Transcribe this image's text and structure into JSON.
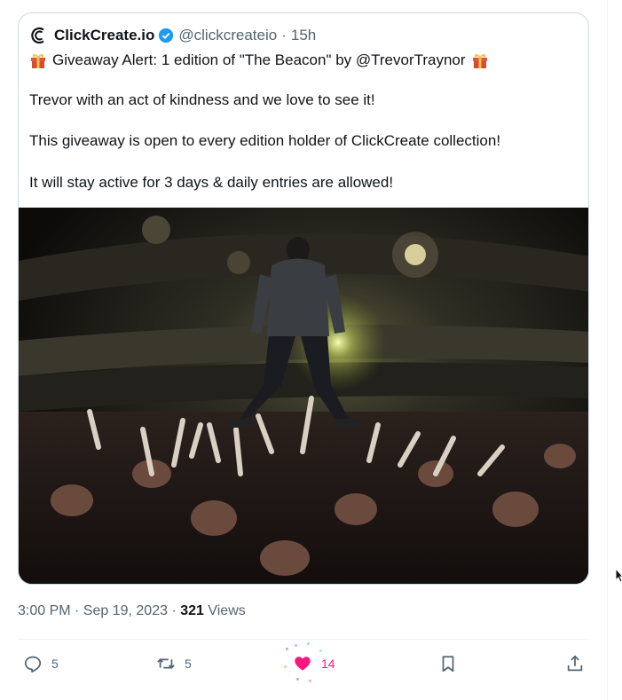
{
  "tweet": {
    "display_name": "ClickCreate.io",
    "handle": "@clickcreateio",
    "separator": "·",
    "age": "15h",
    "line1": "Giveaway Alert: 1 edition of \"The Beacon\" by @TrevorTraynor",
    "line2": "Trevor with an act of kindness and we love to see it!",
    "line3": "This giveaway is open to every edition holder of ClickCreate collection!",
    "line4": "It will stay active for 3 days & daily entries are allowed!"
  },
  "meta": {
    "time_date": "3:00 PM · Sep 19, 2023 · ",
    "views_count": "321",
    "views_label": " Views"
  },
  "actions": {
    "replies": "5",
    "reposts": "5",
    "likes": "14"
  },
  "colors": {
    "accent_like": "#f91880",
    "verified_blue": "#1d9bf0",
    "muted_text": "#536471"
  },
  "icons": [
    "brand-logo-icon",
    "verified-badge-icon",
    "gift-icon",
    "reply-icon",
    "repost-icon",
    "heart-icon",
    "bookmark-icon",
    "share-icon"
  ]
}
